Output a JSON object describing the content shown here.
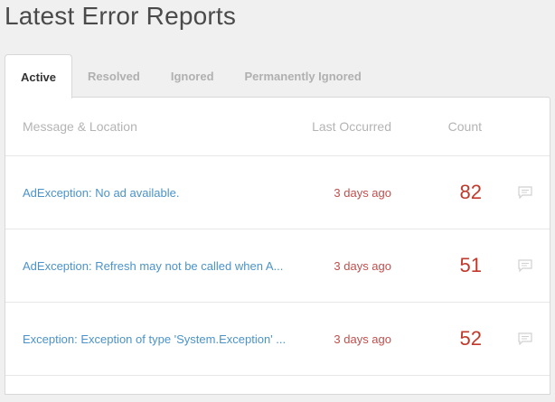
{
  "page": {
    "title": "Latest Error Reports"
  },
  "tabs": [
    {
      "label": "Active",
      "active": true
    },
    {
      "label": "Resolved",
      "active": false
    },
    {
      "label": "Ignored",
      "active": false
    },
    {
      "label": "Permanently Ignored",
      "active": false
    }
  ],
  "table": {
    "headers": {
      "message": "Message & Location",
      "last": "Last Occurred",
      "count": "Count"
    },
    "rows": [
      {
        "message": "AdException: No ad available.",
        "last": "3 days ago",
        "count": "82"
      },
      {
        "message": "AdException: Refresh may not be called when A...",
        "last": "3 days ago",
        "count": "51"
      },
      {
        "message": "Exception: Exception of type 'System.Exception' ...",
        "last": "3 days ago",
        "count": "52"
      }
    ]
  },
  "icons": {
    "row_action": "comment-icon"
  },
  "colors": {
    "link": "#4b93c9",
    "error": "#c0392b",
    "muted": "#b4b4b4"
  }
}
